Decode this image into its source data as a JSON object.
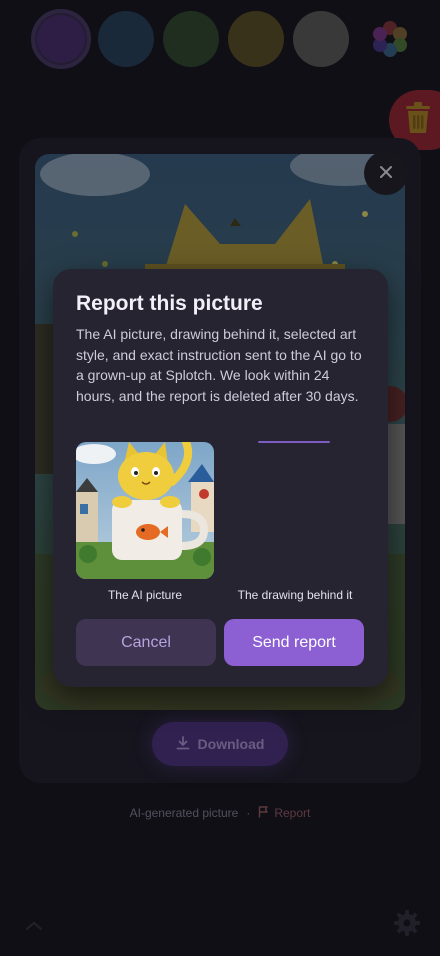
{
  "swatches": {
    "colors": [
      "#3b2457",
      "#213449",
      "#283b26",
      "#4a4020",
      "#4a4a4a"
    ],
    "selected_index": 0,
    "more_colors_icon": "rainbow-flower-icon"
  },
  "trash_icon": "trash-icon",
  "picture_card": {
    "close_icon": "close-icon",
    "download_label": "Download",
    "download_icon": "download-icon"
  },
  "footer": {
    "ai_label": "AI-generated picture",
    "separator": "·",
    "report_label": "Report",
    "report_icon": "flag-icon",
    "collapse_icon": "chevron-up-icon",
    "settings_icon": "gear-icon"
  },
  "report_modal": {
    "title": "Report this picture",
    "body": "The AI picture, drawing behind it, selected art style, and exact instruction sent to the AI go to a grown-up at Splotch. We look within 24 hours, and the report is deleted after 30 days.",
    "ai_picture_caption": "The AI picture",
    "drawing_caption": "The drawing behind it",
    "cancel_label": "Cancel",
    "send_label": "Send report"
  },
  "colors": {
    "background": "#131219",
    "modal": "#262431",
    "accent": "#8c5fd3",
    "cancel_bg": "#3f3452",
    "trash": "#7a1f2a"
  }
}
